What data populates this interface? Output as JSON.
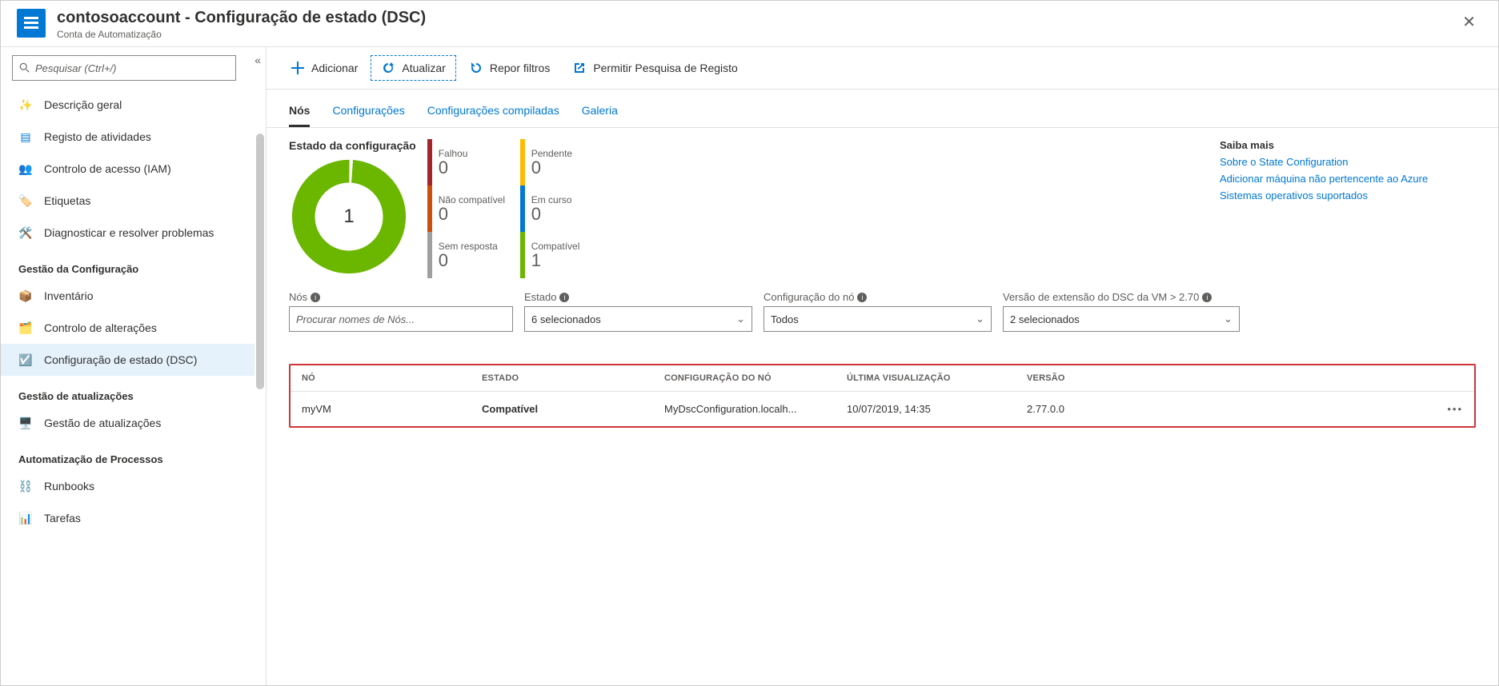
{
  "header": {
    "title": "contosoaccount - Configuração de estado (DSC)",
    "subtitle": "Conta de Automatização"
  },
  "sidebar": {
    "search_placeholder": "Pesquisar (Ctrl+/)",
    "items_top": [
      {
        "label": "Descrição geral",
        "icon": "sparkle"
      },
      {
        "label": "Registo de atividades",
        "icon": "log"
      },
      {
        "label": "Controlo de acesso (IAM)",
        "icon": "iam"
      },
      {
        "label": "Etiquetas",
        "icon": "tag"
      },
      {
        "label": "Diagnosticar e resolver problemas",
        "icon": "wrench"
      }
    ],
    "section1_title": "Gestão da Configuração",
    "items_cfg": [
      {
        "label": "Inventário",
        "icon": "box"
      },
      {
        "label": "Controlo de alterações",
        "icon": "changes"
      },
      {
        "label": "Configuração de estado (DSC)",
        "icon": "dsc",
        "selected": true
      }
    ],
    "section2_title": "Gestão de atualizações",
    "items_upd": [
      {
        "label": "Gestão de atualizações",
        "icon": "update"
      }
    ],
    "section3_title": "Automatização de Processos",
    "items_proc": [
      {
        "label": "Runbooks",
        "icon": "runbook"
      },
      {
        "label": "Tarefas",
        "icon": "tasks"
      }
    ]
  },
  "toolbar": {
    "add": "Adicionar",
    "refresh": "Atualizar",
    "reset": "Repor filtros",
    "log": "Permitir Pesquisa de Registo"
  },
  "tabs": {
    "t0": "Nós",
    "t1": "Configurações",
    "t2": "Configurações compiladas",
    "t3": "Galeria"
  },
  "status": {
    "title": "Estado da configuração",
    "donut_total": "1",
    "tiles": [
      {
        "label": "Falhou",
        "value": "0",
        "color": "#a4262c"
      },
      {
        "label": "Pendente",
        "value": "0",
        "color": "#ffb900"
      },
      {
        "label": "Não compatível",
        "value": "0",
        "color": "#ca5010"
      },
      {
        "label": "Em curso",
        "value": "0",
        "color": "#0078d4"
      },
      {
        "label": "Sem resposta",
        "value": "0",
        "color": "#a19f9d"
      },
      {
        "label": "Compatível",
        "value": "1",
        "color": "#6bb700"
      }
    ]
  },
  "learn": {
    "title": "Saiba mais",
    "links": [
      "Sobre o State Configuration",
      "Adicionar máquina não pertencente ao Azure",
      "Sistemas operativos suportados"
    ]
  },
  "filters": {
    "nodes_label": "Nós",
    "nodes_placeholder": "Procurar nomes de Nós...",
    "state_label": "Estado",
    "state_value": "6 selecionados",
    "nodeconf_label": "Configuração do nó",
    "nodeconf_value": "Todos",
    "ext_label": "Versão de extensão do DSC da VM > 2.70",
    "ext_value": "2 selecionados"
  },
  "table": {
    "headers": {
      "node": "NÓ",
      "state": "ESTADO",
      "conf": "CONFIGURAÇÃO DO NÓ",
      "last": "ÚLTIMA VISUALIZAÇÃO",
      "ver": "VERSÃO"
    },
    "rows": [
      {
        "node": "myVM",
        "state": "Compatível",
        "conf": "MyDscConfiguration.localh...",
        "last": "10/07/2019, 14:35",
        "ver": "2.77.0.0"
      }
    ]
  },
  "chart_data": {
    "type": "pie",
    "title": "Estado da configuração",
    "categories": [
      "Falhou",
      "Pendente",
      "Não compatível",
      "Em curso",
      "Sem resposta",
      "Compatível"
    ],
    "values": [
      0,
      0,
      0,
      0,
      0,
      1
    ],
    "total": 1
  }
}
